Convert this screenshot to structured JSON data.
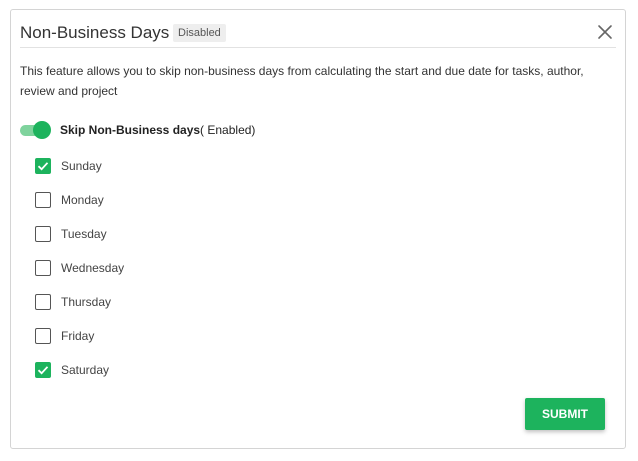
{
  "dialog": {
    "title": "Non-Business Days",
    "badge": "Disabled",
    "description": "This feature allows you to skip non-business days from calculating the start and due date for tasks, author, review and project"
  },
  "toggle": {
    "label": "Skip Non-Business days",
    "state_text": "( Enabled)",
    "on": true,
    "color": "#1db35d"
  },
  "days": [
    {
      "label": "Sunday",
      "checked": true
    },
    {
      "label": "Monday",
      "checked": false
    },
    {
      "label": "Tuesday",
      "checked": false
    },
    {
      "label": "Wednesday",
      "checked": false
    },
    {
      "label": "Thursday",
      "checked": false
    },
    {
      "label": "Friday",
      "checked": false
    },
    {
      "label": "Saturday",
      "checked": true
    }
  ],
  "actions": {
    "submit_label": "SUBMIT"
  },
  "icons": {
    "close": "close-icon",
    "check": "check-icon"
  }
}
